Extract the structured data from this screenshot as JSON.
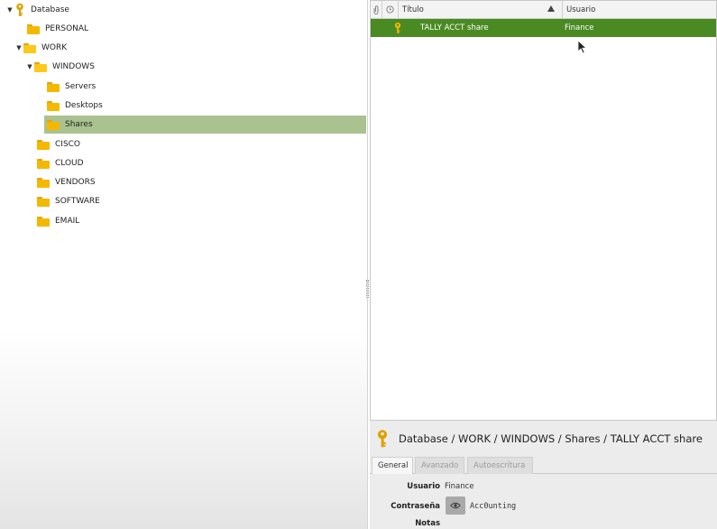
{
  "tree": {
    "root": {
      "label": "Database",
      "expanded": true
    },
    "items": [
      {
        "label": "PERSONAL",
        "depth": 1,
        "expanded": null,
        "selected": false
      },
      {
        "label": "WORK",
        "depth": 1,
        "expanded": true,
        "selected": false
      },
      {
        "label": "WINDOWS",
        "depth": 2,
        "expanded": true,
        "selected": false
      },
      {
        "label": "Servers",
        "depth": 3,
        "expanded": null,
        "selected": false
      },
      {
        "label": "Desktops",
        "depth": 3,
        "expanded": null,
        "selected": false
      },
      {
        "label": "Shares",
        "depth": 3,
        "expanded": null,
        "selected": true
      },
      {
        "label": "CISCO",
        "depth": 2,
        "expanded": null,
        "selected": false
      },
      {
        "label": "CLOUD",
        "depth": 2,
        "expanded": null,
        "selected": false
      },
      {
        "label": "VENDORS",
        "depth": 2,
        "expanded": null,
        "selected": false
      },
      {
        "label": "SOFTWARE",
        "depth": 2,
        "expanded": null,
        "selected": false
      },
      {
        "label": "EMAIL",
        "depth": 2,
        "expanded": null,
        "selected": false
      }
    ]
  },
  "entries": {
    "columns": {
      "attachment_icon": "paperclip-icon",
      "expiry_icon": "clock-icon",
      "title": "Título",
      "username": "Usuario",
      "sort_icon": "sort-ascending-icon"
    },
    "rows": [
      {
        "icon": "key-icon",
        "title": "TALLY ACCT share",
        "username": "Finance",
        "selected": true
      }
    ]
  },
  "details": {
    "path": "Database / WORK / WINDOWS / Shares / TALLY ACCT share",
    "tabs": [
      {
        "label": "General",
        "active": true
      },
      {
        "label": "Avanzado",
        "active": false
      },
      {
        "label": "Autoescritura",
        "active": false
      }
    ],
    "fields": {
      "username_label": "Usuario",
      "username_value": "Finance",
      "password_label": "Contraseña",
      "password_value": "Acc0unting",
      "notes_label": "Notas"
    }
  },
  "colors": {
    "selection_tree": "#a9c28f",
    "selection_entry": "#4a8a22",
    "folder": "#f5b800",
    "key": "#e0a100"
  }
}
